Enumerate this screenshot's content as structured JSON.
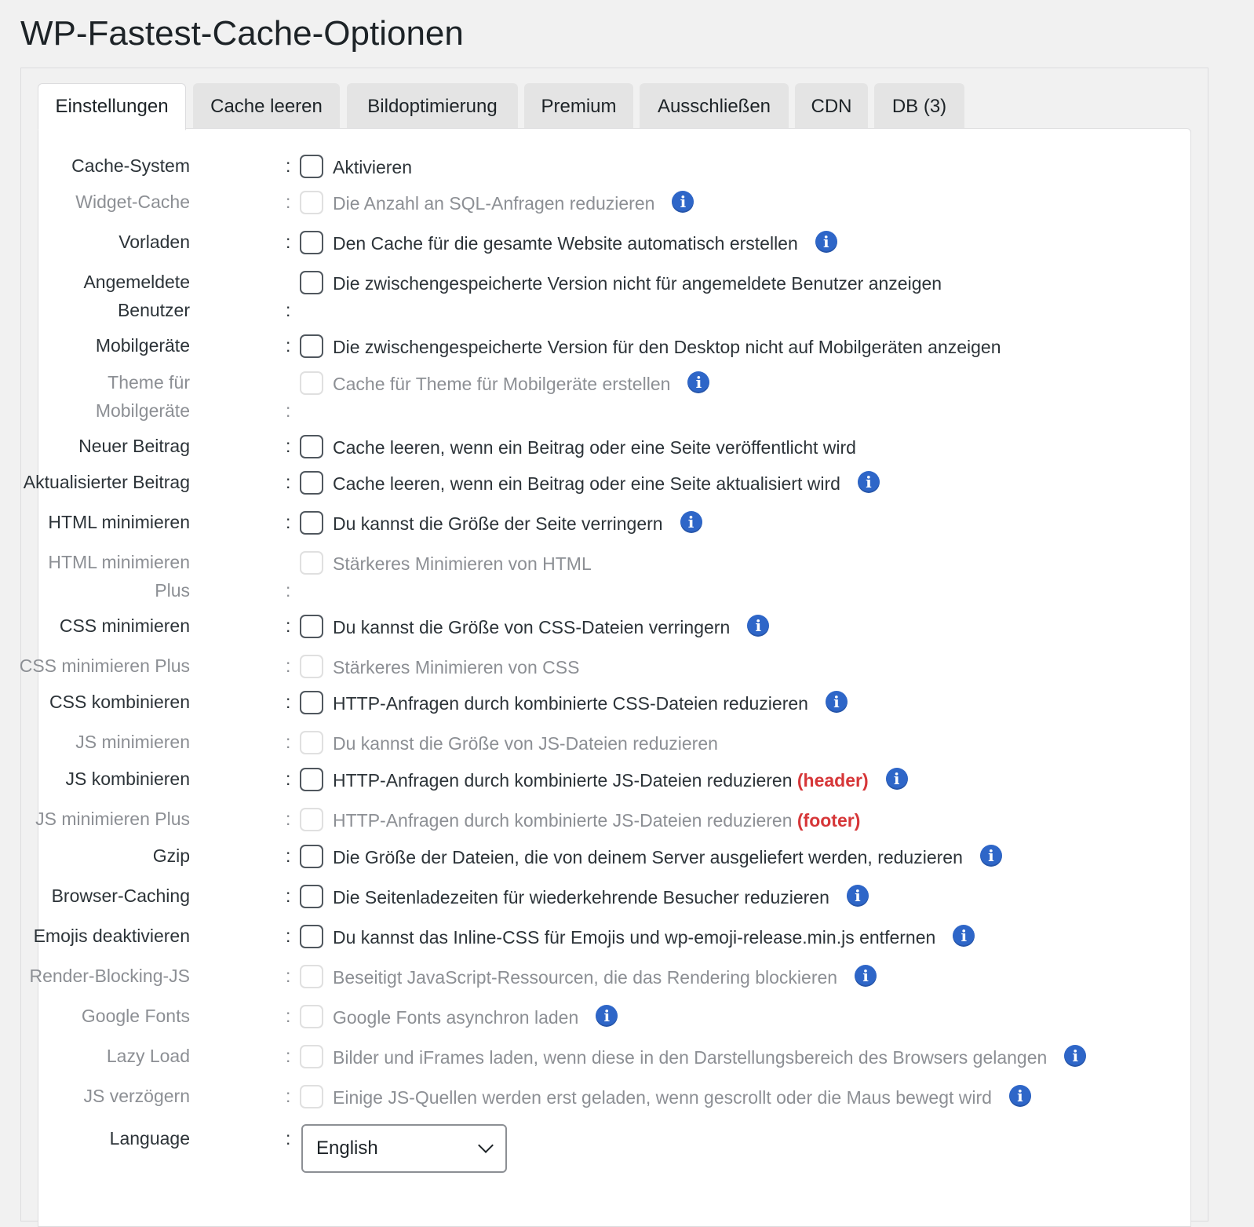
{
  "page_title": "WP-Fastest-Cache-Optionen",
  "tabs": [
    {
      "label": "Einstellungen",
      "active": true
    },
    {
      "label": "Cache leeren"
    },
    {
      "label": "Bildoptimierung"
    },
    {
      "label": "Premium"
    },
    {
      "label": "Ausschließen"
    },
    {
      "label": "CDN"
    },
    {
      "label": "DB (3)"
    }
  ],
  "options": [
    {
      "label": "Cache-System",
      "desc": "Aktivieren",
      "enabled": true,
      "info": false
    },
    {
      "label": "Widget-Cache",
      "desc": "Die Anzahl an SQL-Anfragen reduzieren",
      "enabled": false,
      "info": true
    },
    {
      "label": "Vorladen",
      "desc": "Den Cache für die gesamte Website automatisch erstellen",
      "enabled": true,
      "info": true
    },
    {
      "label": "Angemeldete",
      "label2": "Benutzer",
      "desc": "Die zwischengespeicherte Version nicht für angemeldete Benutzer anzeigen",
      "enabled": true,
      "info": false
    },
    {
      "label": "Mobilgeräte",
      "desc": "Die zwischengespeicherte Version für den Desktop nicht auf Mobilgeräten anzeigen",
      "enabled": true,
      "info": false
    },
    {
      "label": "Theme für",
      "label2": "Mobilgeräte",
      "desc": "Cache für Theme für Mobilgeräte erstellen",
      "enabled": false,
      "info": true
    },
    {
      "label": "Neuer Beitrag",
      "desc": "Cache leeren, wenn ein Beitrag oder eine Seite veröffentlicht wird",
      "enabled": true,
      "info": false
    },
    {
      "label": "Aktualisierter Beitrag",
      "desc": "Cache leeren, wenn ein Beitrag oder eine Seite aktualisiert wird",
      "enabled": true,
      "info": true
    },
    {
      "label": "HTML minimieren",
      "desc": "Du kannst die Größe der Seite verringern",
      "enabled": true,
      "info": true
    },
    {
      "label": "HTML minimieren",
      "label2": "Plus",
      "desc": "Stärkeres Minimieren von HTML",
      "enabled": false,
      "info": false
    },
    {
      "label": "CSS minimieren",
      "desc": "Du kannst die Größe von CSS-Dateien verringern",
      "enabled": true,
      "info": true
    },
    {
      "label": "CSS minimieren Plus",
      "desc": "Stärkeres Minimieren von CSS",
      "enabled": false,
      "info": false
    },
    {
      "label": "CSS kombinieren",
      "desc": "HTTP-Anfragen durch kombinierte CSS-Dateien reduzieren",
      "enabled": true,
      "info": true
    },
    {
      "label": "JS minimieren",
      "desc": "Du kannst die Größe von JS-Dateien reduzieren",
      "enabled": false,
      "info": false
    },
    {
      "label": "JS kombinieren",
      "desc": "HTTP-Anfragen durch kombinierte JS-Dateien reduzieren",
      "highlight": "(header)",
      "enabled": true,
      "info": true
    },
    {
      "label": "JS minimieren Plus",
      "desc": "HTTP-Anfragen durch kombinierte JS-Dateien reduzieren",
      "highlight": "(footer)",
      "enabled": false,
      "info": false
    },
    {
      "label": "Gzip",
      "desc": "Die Größe der Dateien, die von deinem Server ausgeliefert werden, reduzieren",
      "enabled": true,
      "info": true
    },
    {
      "label": "Browser-Caching",
      "desc": "Die Seitenladezeiten für wiederkehrende Besucher reduzieren",
      "enabled": true,
      "info": true
    },
    {
      "label": "Emojis deaktivieren",
      "desc": "Du kannst das Inline-CSS für Emojis und wp-emoji-release.min.js entfernen",
      "enabled": true,
      "info": true
    },
    {
      "label": "Render-Blocking-JS",
      "desc": "Beseitigt JavaScript-Ressourcen, die das Rendering blockieren",
      "enabled": false,
      "info": true
    },
    {
      "label": "Google Fonts",
      "desc": "Google Fonts asynchron laden",
      "enabled": false,
      "info": true
    },
    {
      "label": "Lazy Load",
      "desc": "Bilder und iFrames laden, wenn diese in den Darstellungsbereich des Browsers gelangen",
      "enabled": false,
      "info": true
    },
    {
      "label": "JS verzögern",
      "desc": "Einige JS-Quellen werden erst geladen, wenn gescrollt oder die Maus bewegt wird",
      "enabled": false,
      "info": true
    }
  ],
  "language": {
    "label": "Language",
    "value": "English"
  },
  "colors": {
    "info_icon": "#2e66c8",
    "highlight": "#d63638",
    "disabled_text": "#8c8f94"
  }
}
